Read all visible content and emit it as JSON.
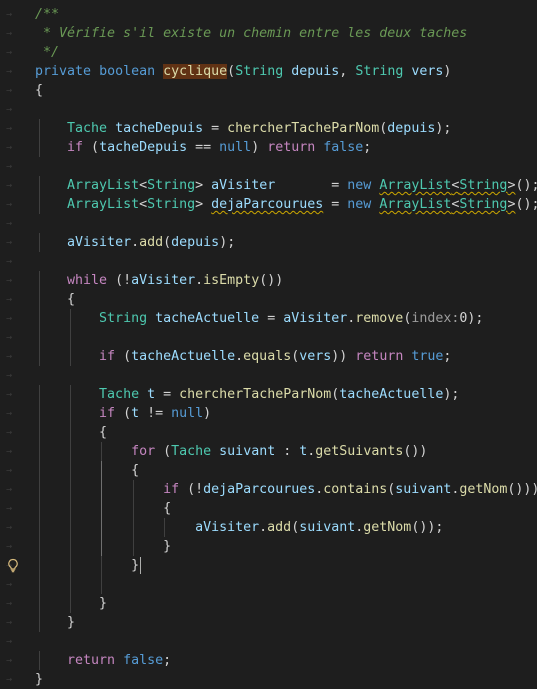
{
  "editor": {
    "lines": [
      {
        "tokens": [
          {
            "t": "/**",
            "c": "c-comment"
          }
        ]
      },
      {
        "tokens": [
          {
            "t": " * Vérifie s'il existe un chemin entre les deux taches",
            "c": "c-comment"
          }
        ]
      },
      {
        "tokens": [
          {
            "t": " */",
            "c": "c-comment"
          }
        ]
      },
      {
        "tokens": [
          {
            "t": "private",
            "c": "c-kw"
          },
          {
            "t": " ",
            "c": "c-plain"
          },
          {
            "t": "boolean",
            "c": "c-kw"
          },
          {
            "t": " ",
            "c": "c-plain"
          },
          {
            "t": "cyclique",
            "c": "hl-fn"
          },
          {
            "t": "(",
            "c": "c-plain"
          },
          {
            "t": "String",
            "c": "c-type"
          },
          {
            "t": " ",
            "c": "c-plain"
          },
          {
            "t": "depuis",
            "c": "c-var"
          },
          {
            "t": ", ",
            "c": "c-plain"
          },
          {
            "t": "String",
            "c": "c-type"
          },
          {
            "t": " ",
            "c": "c-plain"
          },
          {
            "t": "vers",
            "c": "c-var"
          },
          {
            "t": ")",
            "c": "c-plain"
          }
        ]
      },
      {
        "tokens": [
          {
            "t": "{",
            "c": "c-plain"
          }
        ]
      },
      {
        "tokens": []
      },
      {
        "tokens": [
          {
            "t": "    ",
            "c": "c-plain"
          },
          {
            "t": "Tache",
            "c": "c-type"
          },
          {
            "t": " ",
            "c": "c-plain"
          },
          {
            "t": "tacheDepuis",
            "c": "c-var"
          },
          {
            "t": " = ",
            "c": "c-plain"
          },
          {
            "t": "chercherTacheParNom",
            "c": "c-fn"
          },
          {
            "t": "(",
            "c": "c-plain"
          },
          {
            "t": "depuis",
            "c": "c-var"
          },
          {
            "t": ");",
            "c": "c-plain"
          }
        ]
      },
      {
        "tokens": [
          {
            "t": "    ",
            "c": "c-plain"
          },
          {
            "t": "if",
            "c": "c-ctrl"
          },
          {
            "t": " (",
            "c": "c-plain"
          },
          {
            "t": "tacheDepuis",
            "c": "c-var"
          },
          {
            "t": " == ",
            "c": "c-plain"
          },
          {
            "t": "null",
            "c": "c-kw"
          },
          {
            "t": ") ",
            "c": "c-plain"
          },
          {
            "t": "return",
            "c": "c-ctrl"
          },
          {
            "t": " ",
            "c": "c-plain"
          },
          {
            "t": "false",
            "c": "c-kw"
          },
          {
            "t": ";",
            "c": "c-plain"
          }
        ]
      },
      {
        "tokens": []
      },
      {
        "tokens": [
          {
            "t": "    ",
            "c": "c-plain"
          },
          {
            "t": "ArrayList",
            "c": "c-type"
          },
          {
            "t": "<",
            "c": "c-plain"
          },
          {
            "t": "String",
            "c": "c-type"
          },
          {
            "t": "> ",
            "c": "c-plain"
          },
          {
            "t": "aVisiter",
            "c": "c-var"
          },
          {
            "t": "       ",
            "c": "dot"
          },
          {
            "t": "= ",
            "c": "c-plain"
          },
          {
            "t": "new",
            "c": "c-kw"
          },
          {
            "t": " ",
            "c": "c-plain"
          },
          {
            "t": "ArrayList",
            "c": "c-type squig"
          },
          {
            "t": "<",
            "c": "c-plain squig"
          },
          {
            "t": "String",
            "c": "c-type squig"
          },
          {
            "t": ">",
            "c": "c-plain squig"
          },
          {
            "t": "();",
            "c": "c-plain"
          }
        ]
      },
      {
        "tokens": [
          {
            "t": "    ",
            "c": "c-plain"
          },
          {
            "t": "ArrayList",
            "c": "c-type"
          },
          {
            "t": "<",
            "c": "c-plain"
          },
          {
            "t": "String",
            "c": "c-type"
          },
          {
            "t": "> ",
            "c": "c-plain"
          },
          {
            "t": "dejaParcourues",
            "c": "c-var squig"
          },
          {
            "t": " = ",
            "c": "c-plain"
          },
          {
            "t": "new",
            "c": "c-kw"
          },
          {
            "t": " ",
            "c": "c-plain"
          },
          {
            "t": "ArrayList",
            "c": "c-type squig"
          },
          {
            "t": "<",
            "c": "c-plain squig"
          },
          {
            "t": "String",
            "c": "c-type squig"
          },
          {
            "t": ">",
            "c": "c-plain squig"
          },
          {
            "t": "();",
            "c": "c-plain"
          }
        ]
      },
      {
        "tokens": []
      },
      {
        "tokens": [
          {
            "t": "    ",
            "c": "c-plain"
          },
          {
            "t": "aVisiter",
            "c": "c-var"
          },
          {
            "t": ".",
            "c": "c-plain"
          },
          {
            "t": "add",
            "c": "c-fn"
          },
          {
            "t": "(",
            "c": "c-plain"
          },
          {
            "t": "depuis",
            "c": "c-var"
          },
          {
            "t": ");",
            "c": "c-plain"
          }
        ]
      },
      {
        "tokens": []
      },
      {
        "tokens": [
          {
            "t": "    ",
            "c": "c-plain"
          },
          {
            "t": "while",
            "c": "c-ctrl"
          },
          {
            "t": " (!",
            "c": "c-plain"
          },
          {
            "t": "aVisiter",
            "c": "c-var"
          },
          {
            "t": ".",
            "c": "c-plain"
          },
          {
            "t": "isEmpty",
            "c": "c-fn"
          },
          {
            "t": "())",
            "c": "c-plain"
          }
        ]
      },
      {
        "tokens": [
          {
            "t": "    {",
            "c": "c-plain"
          }
        ]
      },
      {
        "tokens": [
          {
            "t": "        ",
            "c": "c-plain"
          },
          {
            "t": "String",
            "c": "c-type"
          },
          {
            "t": " ",
            "c": "c-plain"
          },
          {
            "t": "tacheActuelle",
            "c": "c-var"
          },
          {
            "t": " = ",
            "c": "c-plain"
          },
          {
            "t": "aVisiter",
            "c": "c-var"
          },
          {
            "t": ".",
            "c": "c-plain"
          },
          {
            "t": "remove",
            "c": "c-fn"
          },
          {
            "t": "(",
            "c": "c-plain"
          },
          {
            "t": "index:",
            "c": "c-hint"
          },
          {
            "t": "0",
            "c": "c-plain"
          },
          {
            "t": ");",
            "c": "c-plain"
          }
        ]
      },
      {
        "tokens": []
      },
      {
        "tokens": [
          {
            "t": "        ",
            "c": "c-plain"
          },
          {
            "t": "if",
            "c": "c-ctrl"
          },
          {
            "t": " (",
            "c": "c-plain"
          },
          {
            "t": "tacheActuelle",
            "c": "c-var"
          },
          {
            "t": ".",
            "c": "c-plain"
          },
          {
            "t": "equals",
            "c": "c-fn"
          },
          {
            "t": "(",
            "c": "c-plain"
          },
          {
            "t": "vers",
            "c": "c-var"
          },
          {
            "t": ")) ",
            "c": "c-plain"
          },
          {
            "t": "return",
            "c": "c-ctrl"
          },
          {
            "t": " ",
            "c": "c-plain"
          },
          {
            "t": "true",
            "c": "c-kw"
          },
          {
            "t": ";",
            "c": "c-plain"
          }
        ]
      },
      {
        "tokens": []
      },
      {
        "tokens": [
          {
            "t": "        ",
            "c": "c-plain"
          },
          {
            "t": "Tache",
            "c": "c-type"
          },
          {
            "t": " ",
            "c": "c-plain"
          },
          {
            "t": "t",
            "c": "c-var"
          },
          {
            "t": " = ",
            "c": "c-plain"
          },
          {
            "t": "chercherTacheParNom",
            "c": "c-fn"
          },
          {
            "t": "(",
            "c": "c-plain"
          },
          {
            "t": "tacheActuelle",
            "c": "c-var"
          },
          {
            "t": ");",
            "c": "c-plain"
          }
        ]
      },
      {
        "tokens": [
          {
            "t": "        ",
            "c": "c-plain"
          },
          {
            "t": "if",
            "c": "c-ctrl"
          },
          {
            "t": " (",
            "c": "c-plain"
          },
          {
            "t": "t",
            "c": "c-var"
          },
          {
            "t": " != ",
            "c": "c-plain"
          },
          {
            "t": "null",
            "c": "c-kw"
          },
          {
            "t": ")",
            "c": "c-plain"
          }
        ]
      },
      {
        "tokens": [
          {
            "t": "        {",
            "c": "c-plain"
          }
        ]
      },
      {
        "tokens": [
          {
            "t": "            ",
            "c": "c-plain"
          },
          {
            "t": "for",
            "c": "c-ctrl"
          },
          {
            "t": " (",
            "c": "c-plain"
          },
          {
            "t": "Tache",
            "c": "c-type"
          },
          {
            "t": " ",
            "c": "c-plain"
          },
          {
            "t": "suivant",
            "c": "c-var"
          },
          {
            "t": " : ",
            "c": "c-plain"
          },
          {
            "t": "t",
            "c": "c-var"
          },
          {
            "t": ".",
            "c": "c-plain"
          },
          {
            "t": "getSuivants",
            "c": "c-fn"
          },
          {
            "t": "())",
            "c": "c-plain"
          }
        ]
      },
      {
        "tokens": [
          {
            "t": "            {",
            "c": "c-plain"
          }
        ]
      },
      {
        "tokens": [
          {
            "t": "                ",
            "c": "c-plain"
          },
          {
            "t": "if",
            "c": "c-ctrl"
          },
          {
            "t": " (!",
            "c": "c-plain"
          },
          {
            "t": "dejaParcourues",
            "c": "c-var"
          },
          {
            "t": ".",
            "c": "c-plain"
          },
          {
            "t": "contains",
            "c": "c-fn"
          },
          {
            "t": "(",
            "c": "c-plain"
          },
          {
            "t": "suivant",
            "c": "c-var"
          },
          {
            "t": ".",
            "c": "c-plain"
          },
          {
            "t": "getNom",
            "c": "c-fn"
          },
          {
            "t": "()))",
            "c": "c-plain"
          }
        ]
      },
      {
        "tokens": [
          {
            "t": "                {",
            "c": "c-plain"
          }
        ]
      },
      {
        "tokens": [
          {
            "t": "                    ",
            "c": "c-plain"
          },
          {
            "t": "aVisiter",
            "c": "c-var"
          },
          {
            "t": ".",
            "c": "c-plain"
          },
          {
            "t": "add",
            "c": "c-fn"
          },
          {
            "t": "(",
            "c": "c-plain"
          },
          {
            "t": "suivant",
            "c": "c-var"
          },
          {
            "t": ".",
            "c": "c-plain"
          },
          {
            "t": "getNom",
            "c": "c-fn"
          },
          {
            "t": "());",
            "c": "c-plain"
          }
        ]
      },
      {
        "tokens": [
          {
            "t": "                }",
            "c": "c-plain"
          }
        ]
      },
      {
        "tokens": [
          {
            "t": "            }",
            "c": "c-plain"
          }
        ]
      },
      {
        "tokens": []
      },
      {
        "tokens": [
          {
            "t": "        }",
            "c": "c-plain"
          }
        ]
      },
      {
        "tokens": [
          {
            "t": "    }",
            "c": "c-plain"
          }
        ]
      },
      {
        "tokens": []
      },
      {
        "tokens": [
          {
            "t": "    ",
            "c": "c-plain"
          },
          {
            "t": "return",
            "c": "c-ctrl"
          },
          {
            "t": " ",
            "c": "c-plain"
          },
          {
            "t": "false",
            "c": "c-kw"
          },
          {
            "t": ";",
            "c": "c-plain"
          }
        ]
      },
      {
        "tokens": [
          {
            "t": "}",
            "c": "c-plain"
          }
        ]
      }
    ],
    "lightbulb_icon": "lightbulb-icon",
    "whitespace_arrow_glyph": "→",
    "colors": {
      "background": "#1e1e1e",
      "comment": "#6a9955",
      "keyword": "#569cd6",
      "type": "#4ec9b0",
      "variable": "#9cdcfe",
      "function": "#dcdcaa",
      "control": "#c586c0",
      "selection_highlight": "#613214",
      "warning_squiggle": "#cca700"
    }
  }
}
